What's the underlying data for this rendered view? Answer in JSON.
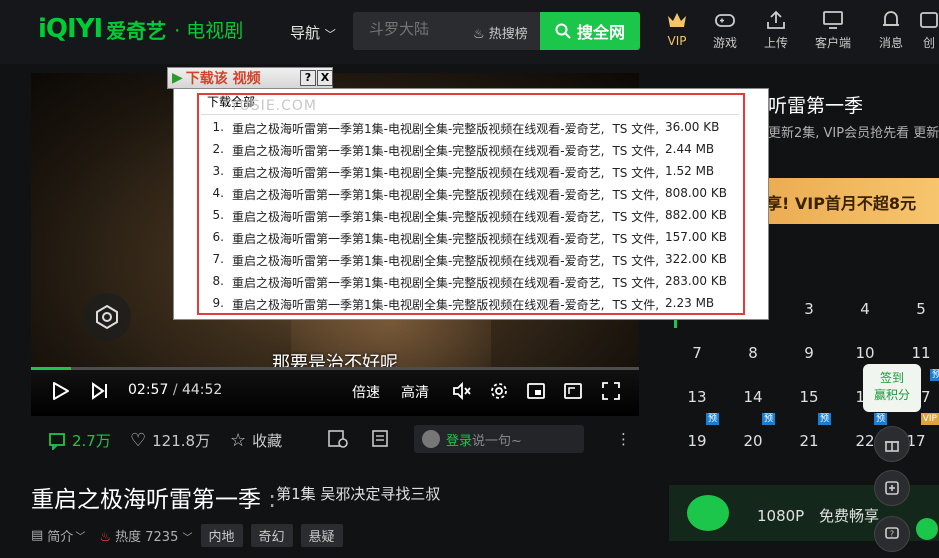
{
  "header": {
    "logo_mark": "iQIYI",
    "logo_text": "爱奇艺",
    "logo_section": "· 电视剧",
    "nav_label": "导航",
    "search_placeholder": "斗罗大陆",
    "hot_search_label": "热搜榜",
    "search_button": "搜全网",
    "nav_items": [
      {
        "label": "VIP",
        "icon": "crown-icon"
      },
      {
        "label": "游戏",
        "icon": "gamepad-icon"
      },
      {
        "label": "上传",
        "icon": "upload-icon"
      },
      {
        "label": "客户端",
        "icon": "monitor-icon"
      },
      {
        "label": "消息",
        "icon": "bell-icon"
      },
      {
        "label": "创",
        "icon": "create-icon"
      }
    ],
    "accent_color": "#1cc64a"
  },
  "player": {
    "subtitle": "那要是治不好呢",
    "current_time": "02:57",
    "time_separator": "/",
    "duration": "44:52",
    "progress_fraction": 0.066,
    "speed_label": "倍速",
    "quality_label": "高清"
  },
  "download_dialog": {
    "tab_title": "下载该 视频",
    "help_label": "?",
    "close_label": "X",
    "download_all": "下载全部",
    "watermark": "YUSIE.COM",
    "files": [
      {
        "num": "1.",
        "name": "重启之极海听雷第一季第1集-电视剧全集-完整版视频在线观看-爱奇艺,",
        "type": "TS 文件,",
        "size": "36.00 KB"
      },
      {
        "num": "2.",
        "name": "重启之极海听雷第一季第1集-电视剧全集-完整版视频在线观看-爱奇艺,",
        "type": "TS 文件,",
        "size": "2.44 MB"
      },
      {
        "num": "3.",
        "name": "重启之极海听雷第一季第1集-电视剧全集-完整版视频在线观看-爱奇艺,",
        "type": "TS 文件,",
        "size": "1.52 MB"
      },
      {
        "num": "4.",
        "name": "重启之极海听雷第一季第1集-电视剧全集-完整版视频在线观看-爱奇艺,",
        "type": "TS 文件,",
        "size": "808.00 KB"
      },
      {
        "num": "5.",
        "name": "重启之极海听雷第一季第1集-电视剧全集-完整版视频在线观看-爱奇艺,",
        "type": "TS 文件,",
        "size": "882.00 KB"
      },
      {
        "num": "6.",
        "name": "重启之极海听雷第一季第1集-电视剧全集-完整版视频在线观看-爱奇艺,",
        "type": "TS 文件,",
        "size": "157.00 KB"
      },
      {
        "num": "7.",
        "name": "重启之极海听雷第一季第1集-电视剧全集-完整版视频在线观看-爱奇艺,",
        "type": "TS 文件,",
        "size": "322.00 KB"
      },
      {
        "num": "8.",
        "name": "重启之极海听雷第一季第1集-电视剧全集-完整版视频在线观看-爱奇艺,",
        "type": "TS 文件,",
        "size": "283.00 KB"
      },
      {
        "num": "9.",
        "name": "重启之极海听雷第一季第1集-电视剧全集-完整版视频在线观看-爱奇艺,",
        "type": "TS 文件,",
        "size": "2.23 MB"
      }
    ]
  },
  "actions": {
    "comments": "2.7万",
    "likes": "121.8万",
    "collect": "收藏",
    "login_link": "登录",
    "comment_placeholder": "说一句~",
    "more": "⋮"
  },
  "video_info": {
    "series_title": "重启之极海听雷第一季",
    "separator": " : ",
    "episode_title": "第1集 吴邪决定寻找三叔",
    "intro_label": "简介",
    "heat_label": "热度",
    "heat_value": "7235",
    "tags": [
      "内地",
      "奇幻",
      "悬疑"
    ]
  },
  "right_panel": {
    "title": "听雷第一季",
    "subtitle": "更新2集, VIP会员抢先看 更新",
    "banner": "享! VIP首月不超8元",
    "episodes": [
      {
        "num": "3",
        "badge": ""
      },
      {
        "num": "4",
        "badge": ""
      },
      {
        "num": "5",
        "badge": ""
      },
      {
        "num": "7",
        "badge": ""
      },
      {
        "num": "8",
        "badge": ""
      },
      {
        "num": "9",
        "badge": ""
      },
      {
        "num": "10",
        "badge": ""
      },
      {
        "num": "11",
        "badge": ""
      },
      {
        "num": "13",
        "badge": ""
      },
      {
        "num": "14",
        "badge": ""
      },
      {
        "num": "15",
        "badge": ""
      },
      {
        "num": "16",
        "badge": ""
      },
      {
        "num": "17",
        "badge": "预"
      },
      {
        "num": "19",
        "badge": "预"
      },
      {
        "num": "20",
        "badge": "预"
      },
      {
        "num": "21",
        "badge": "预"
      },
      {
        "num": "22",
        "badge": "预"
      },
      {
        "num": "17",
        "badge": "VIP"
      }
    ],
    "bottom_resolution": "1080P",
    "bottom_text": "免费畅享",
    "tooltip_line1": "签到",
    "tooltip_line2": "赢积分"
  }
}
